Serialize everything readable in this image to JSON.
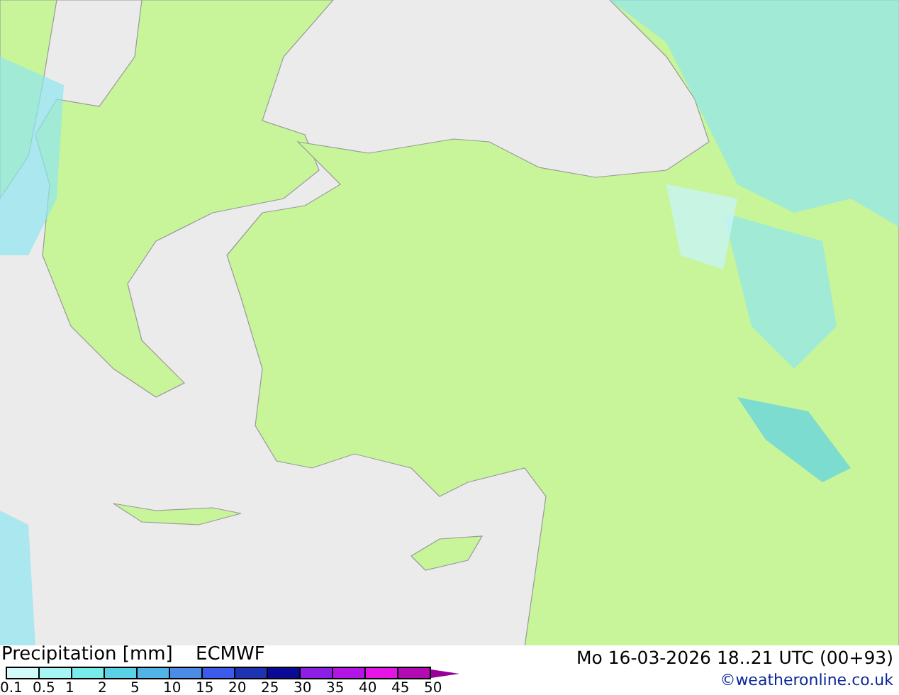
{
  "legend": {
    "title": "Precipitation [mm]",
    "model": "ECMWF",
    "swatches": [
      {
        "color": "#d2faf8"
      },
      {
        "color": "#a5f5f5"
      },
      {
        "color": "#78ebeb"
      },
      {
        "color": "#5ad2e6"
      },
      {
        "color": "#50b4e6"
      },
      {
        "color": "#4b8ce6"
      },
      {
        "color": "#3c5aeb"
      },
      {
        "color": "#1e32b4"
      },
      {
        "color": "#0a0a96"
      },
      {
        "color": "#8c1ee6"
      },
      {
        "color": "#b414e6"
      },
      {
        "color": "#e614e6"
      },
      {
        "color": "#b40ab4"
      }
    ],
    "ticks": [
      "0.1",
      "0.5",
      "1",
      "2",
      "5",
      "10",
      "15",
      "20",
      "25",
      "30",
      "35",
      "40",
      "45",
      "50"
    ]
  },
  "valid_time": "Mo 16-03-2026 18..21 UTC (00+93)",
  "credit": "©weatheronline.co.uk"
}
